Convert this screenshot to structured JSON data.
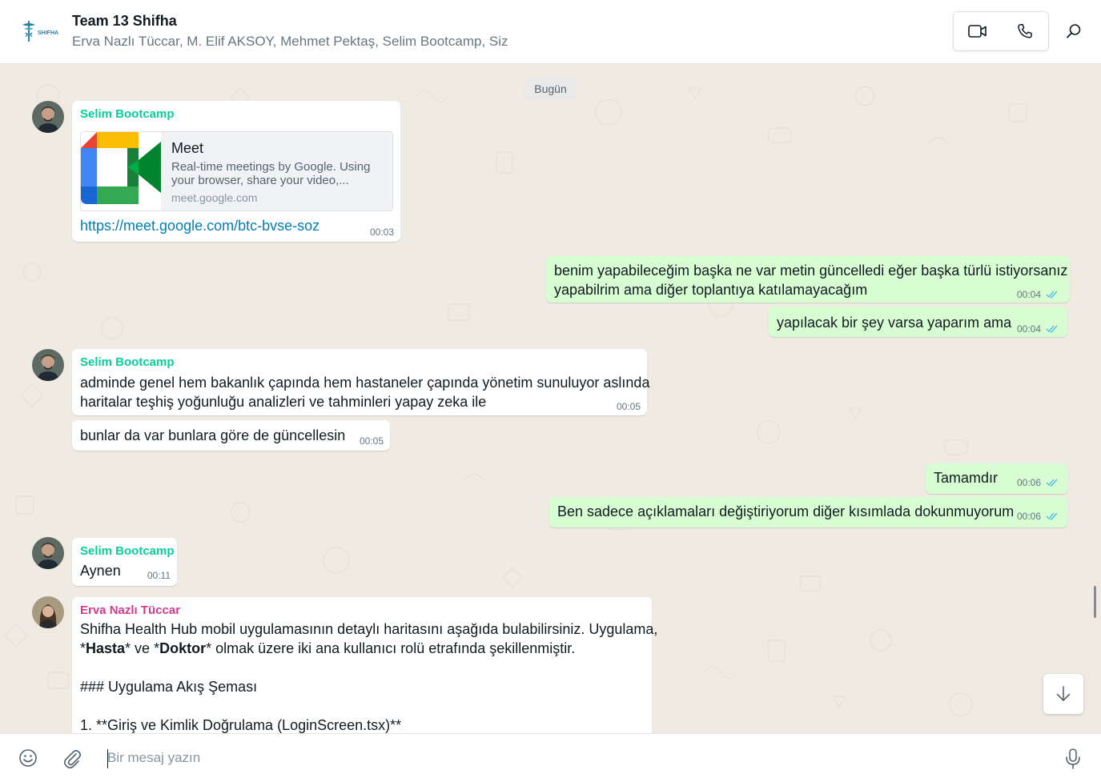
{
  "header": {
    "logo_text": "SHIFHA",
    "title": "Team 13 Shifha",
    "members": "Erva Nazlı Tüccar, M. Elif AKSOY, Mehmet Pektaş, Selim Bootcamp, Siz",
    "icons": {
      "video": "video-camera-icon",
      "voice": "phone-icon",
      "search": "search-icon"
    }
  },
  "chat": {
    "date_chip": "Bugün",
    "messages": [
      {
        "direction": "incoming",
        "sender": "Selim Bootcamp",
        "link_preview": {
          "title": "Meet",
          "description_lines": [
            "Real-time meetings by Google. Using",
            "your browser, share your video,..."
          ],
          "domain": "meet.google.com"
        },
        "url": "https://meet.google.com/btc-bvse-soz",
        "time": "00:03"
      },
      {
        "direction": "outgoing",
        "lines": [
          "benim yapabileceğim başka ne var metin güncelledi eğer başka türlü istiyorsanız",
          "yapabilrim ama diğer toplantıya katılamayacağım"
        ],
        "time": "00:04",
        "status": "read"
      },
      {
        "direction": "outgoing",
        "text": "yapılacak bir şey varsa yaparım ama",
        "time": "00:04",
        "status": "read"
      },
      {
        "direction": "incoming",
        "sender": "Selim Bootcamp",
        "lines": [
          "adminde genel hem bakanlık çapında hem hastaneler çapında yönetim sunuluyor aslında",
          "haritalar teşhiş yoğunluğu analizleri ve tahminleri yapay zeka ile"
        ],
        "time": "00:05"
      },
      {
        "direction": "incoming",
        "text": "bunlar da var bunlara göre de güncellesin",
        "time": "00:05"
      },
      {
        "direction": "outgoing",
        "text": "Tamamdır",
        "time": "00:06",
        "status": "read"
      },
      {
        "direction": "outgoing",
        "text": "Ben sadece açıklamaları değiştiriyorum diğer kısımlada dokunmuyorum",
        "time": "00:06",
        "status": "read"
      },
      {
        "direction": "incoming",
        "sender": "Selim Bootcamp",
        "text": "Aynen",
        "time": "00:11"
      },
      {
        "direction": "incoming",
        "sender": "Erva Nazlı Tüccar",
        "line1": "Shifha Health Hub mobil uygulamasının detaylı haritasını aşağıda bulabilirsiniz. Uygulama,",
        "line2": {
          "a": "*",
          "b": "Hasta",
          "c": "* ve *",
          "d": "Doktor",
          "e": "* olmak üzere iki ana kullanıcı rolü etrafında şekillenmiştir."
        },
        "line3": "### Uygulama Akış Şeması",
        "line4": "1.  **Giriş ve Kimlik Doğrulama (LoginScreen.tsx)**"
      }
    ],
    "colors": {
      "incoming": "#ffffff",
      "outgoing": "#d9fdd3",
      "selim": "#06cf9c",
      "erva": "#d63a8a",
      "read_ticks": "#53bdeb",
      "link": "#027eb5"
    }
  },
  "composer": {
    "placeholder": "Bir mesaj yazın",
    "value": "",
    "icons": {
      "emoji": "smiley-icon",
      "attach": "paperclip-icon",
      "mic": "microphone-icon"
    }
  },
  "controls": {
    "scroll_down": "arrow-down-icon"
  }
}
